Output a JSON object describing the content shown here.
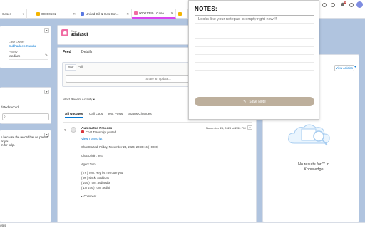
{
  "tabs": [
    {
      "label": "Cases"
    },
    {
      "label": "00000501"
    },
    {
      "label": "United Oil & Gas Cor..."
    },
    {
      "label": "00001349 | Case"
    },
    {
      "label": ""
    }
  ],
  "notification_count": "4",
  "left_panel": {
    "case_owner_label": "Case Owner",
    "case_owner_value": "Subhadeep Kundu",
    "priority_label": "Priority",
    "priority_value": "Medium",
    "record_text": "dated record.",
    "path_text": "n because the record has no parent or you\nm for help."
  },
  "case_header": {
    "type_label": "Case",
    "name": "adsfasdf"
  },
  "detail_tabs": [
    "Feed",
    "Details"
  ],
  "publisher": {
    "tabs": [
      "Post",
      "Poll"
    ],
    "share_placeholder": "Share an update..."
  },
  "feed": {
    "sort_label": "Most Recent Activity",
    "filters": [
      "All Updates",
      "Call Logs",
      "Text Posts",
      "Status Changes"
    ],
    "post": {
      "author": "Automated Process",
      "subtitle": "Chat Transcript posted",
      "timestamp": "November 24, 2023 at 2:30 PM",
      "view_link": "View Transcript",
      "lines": [
        "Chat Started: Friday, November 24, 2023, 22:30:16 (+0000)",
        "Chat Origin: test",
        "Agent Tom",
        "( 7s ) Tom: Hey let me route you",
        "( 9s ) slack! Soultions",
        "( 20s ) Tom: asdfasdfa",
        "( 1m 27s ) Tom: asdfsf"
      ],
      "comment_label": "Comment"
    }
  },
  "notes": {
    "title": "NOTES:",
    "placeholder": "Looks like your notepad is empty right now!!!",
    "save_label": "Save Note"
  },
  "knowledge": {
    "view_articles": "View Articles",
    "empty_message": "No results for \"\" in Knowledge"
  },
  "footer_text": "otes",
  "colors": {
    "background": "#b0c4df",
    "accent": "#0176d3",
    "case_icon": "#f06ba3",
    "save_note_bg": "#bdaf9c",
    "active_tab": "#d946ef"
  }
}
